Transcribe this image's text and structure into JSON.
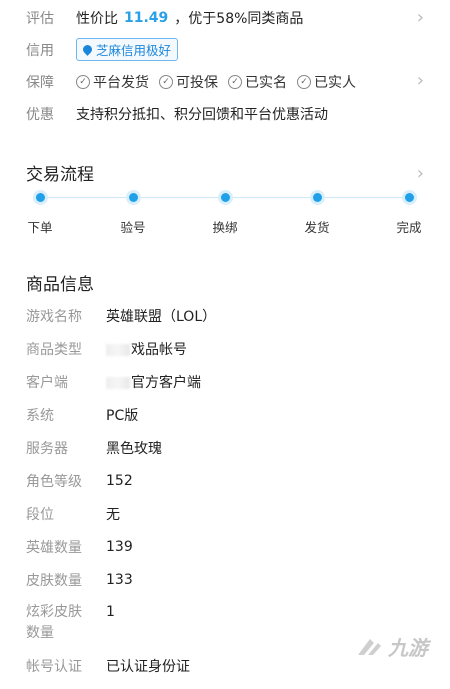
{
  "rows": {
    "eval": {
      "label": "评估",
      "prefix": "性价比 ",
      "score": "11.49",
      "suffix": "，优于58%同类商品"
    },
    "credit": {
      "label": "信用",
      "badge": "芝麻信用极好"
    },
    "guarantee": {
      "label": "保障",
      "items": [
        "平台发货",
        "可投保",
        "已实名",
        "已实人"
      ]
    },
    "promo": {
      "label": "优惠",
      "text": "支持积分抵扣、积分回馈和平台优惠活动"
    }
  },
  "flow": {
    "title": "交易流程",
    "steps": [
      "下单",
      "验号",
      "换绑",
      "发货",
      "完成"
    ]
  },
  "info": {
    "title": "商品信息",
    "items": [
      {
        "label": "游戏名称",
        "value": "英雄联盟（LOL）"
      },
      {
        "label": "商品类型",
        "value": "戏品帐号"
      },
      {
        "label": "客户端",
        "value": "官方客户端"
      },
      {
        "label": "系统",
        "value": "PC版"
      },
      {
        "label": "服务器",
        "value": "黑色玫瑰"
      },
      {
        "label": "角色等级",
        "value": "152"
      },
      {
        "label": "段位",
        "value": "无"
      },
      {
        "label": "英雄数量",
        "value": "139"
      },
      {
        "label": "皮肤数量",
        "value": "133"
      },
      {
        "label": "炫彩皮肤",
        "label2": "数量",
        "value": "1"
      },
      {
        "label": "帐号认证",
        "value": "已认证身份证"
      }
    ]
  },
  "watermark": "九游"
}
